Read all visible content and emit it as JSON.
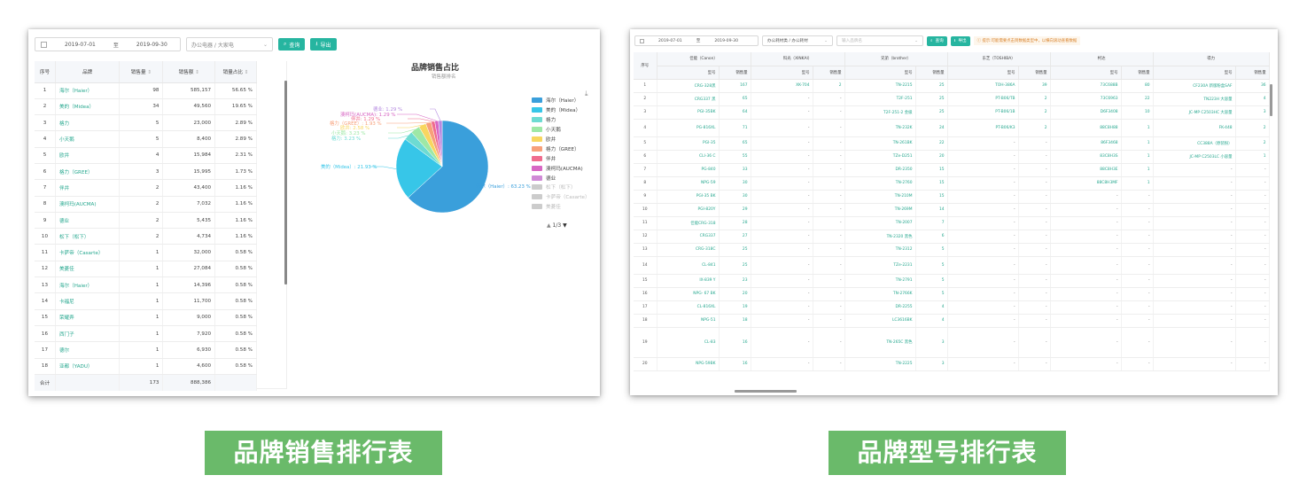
{
  "left": {
    "toolbar": {
      "start_date": "2019-07-01",
      "separator": "至",
      "end_date": "2019-09-30",
      "category": "办公电器 / 大家电",
      "query_label": "查询",
      "export_label": "导出"
    },
    "table": {
      "headers": [
        "序号",
        "品牌",
        "销售量",
        "销售额",
        "销量占比"
      ],
      "rows": [
        [
          "1",
          "海尔（Haier）",
          "98",
          "585,157",
          "56.65 %"
        ],
        [
          "2",
          "美的（Midea）",
          "34",
          "49,560",
          "19.65 %"
        ],
        [
          "3",
          "格力",
          "5",
          "23,000",
          "2.89 %"
        ],
        [
          "4",
          "小天鹅",
          "5",
          "8,400",
          "2.89 %"
        ],
        [
          "5",
          "欧井",
          "4",
          "15,984",
          "2.31 %"
        ],
        [
          "6",
          "格力（GREE）",
          "3",
          "15,995",
          "1.73 %"
        ],
        [
          "7",
          "伴井",
          "2",
          "43,400",
          "1.16 %"
        ],
        [
          "8",
          "澳柯玛(AUCMA)",
          "2",
          "7,032",
          "1.16 %"
        ],
        [
          "9",
          "德业",
          "2",
          "5,435",
          "1.16 %"
        ],
        [
          "10",
          "松下（松下）",
          "2",
          "4,734",
          "1.16 %"
        ],
        [
          "11",
          "卡萨帝（Casarte）",
          "1",
          "32,000",
          "0.58 %"
        ],
        [
          "12",
          "美菱佳",
          "1",
          "27,084",
          "0.58 %"
        ],
        [
          "13",
          "海尔（Haier）",
          "1",
          "14,396",
          "0.58 %"
        ],
        [
          "14",
          "卡福尼",
          "1",
          "11,700",
          "0.58 %"
        ],
        [
          "15",
          "荣耀弄",
          "1",
          "9,000",
          "0.58 %"
        ],
        [
          "16",
          "西门子",
          "1",
          "7,920",
          "0.58 %"
        ],
        [
          "17",
          "德尔",
          "1",
          "6,930",
          "0.58 %"
        ],
        [
          "18",
          "亚都（YADU）",
          "1",
          "4,600",
          "0.58 %"
        ]
      ],
      "total": [
        "合计",
        "",
        "173",
        "888,386",
        ""
      ]
    },
    "chart": {
      "title": "品牌销售占比",
      "subtitle": "销售额排名",
      "pager": "1/3",
      "pie_labels": [
        "海尔（Haier）: 63.23 %",
        "美的（Midea）: 21.93 %",
        "德业: 1.29 %",
        "澳柯玛(AUCMA): 1.29 %",
        "伴井: 1.29 %",
        "格力（GREE）: 1.93 %",
        "欧井: 2.58 %",
        "小天鹅: 3.23 %",
        "格力: 3.23 %"
      ]
    },
    "chart_data": {
      "type": "pie",
      "title": "品牌销售占比",
      "subtitle": "销售额排名",
      "slices": [
        {
          "name": "海尔（Haier）",
          "value": 63.23,
          "color": "#3a9fdb"
        },
        {
          "name": "美的（Midea）",
          "value": 21.93,
          "color": "#37c6e8"
        },
        {
          "name": "格力",
          "value": 3.23,
          "color": "#6ddbd2"
        },
        {
          "name": "小天鹅",
          "value": 3.23,
          "color": "#9ee8a6"
        },
        {
          "name": "欧井",
          "value": 2.58,
          "color": "#f8d65f"
        },
        {
          "name": "格力（GREE）",
          "value": 1.93,
          "color": "#f7a07a"
        },
        {
          "name": "伴井",
          "value": 1.29,
          "color": "#f06c8e"
        },
        {
          "name": "澳柯玛(AUCMA)",
          "value": 1.29,
          "color": "#d867c4"
        },
        {
          "name": "德业",
          "value": 1.29,
          "color": "#b58ae0"
        }
      ],
      "legend": [
        {
          "name": "海尔（Haier）",
          "color": "#3a9fdb"
        },
        {
          "name": "美的（Midea）",
          "color": "#37c6e8"
        },
        {
          "name": "格力",
          "color": "#6ddbd2"
        },
        {
          "name": "小天鹅",
          "color": "#9ee8a6"
        },
        {
          "name": "欧井",
          "color": "#f8d65f"
        },
        {
          "name": "格力（GREE）",
          "color": "#f7a07a"
        },
        {
          "name": "伴井",
          "color": "#f06c8e"
        },
        {
          "name": "澳柯玛(AUCMA)",
          "color": "#d867c4"
        },
        {
          "name": "德业",
          "color": "#d08ad6"
        },
        {
          "name": "松下（松下）",
          "color": "#cccccc"
        },
        {
          "name": "卡萨帝（Casarte）",
          "color": "#cccccc"
        },
        {
          "name": "美菱佳",
          "color": "#cccccc"
        }
      ],
      "legend_position": "right"
    }
  },
  "right": {
    "toolbar": {
      "start_date": "2019-07-01",
      "separator": "至",
      "end_date": "2019-09-30",
      "category": "办公耗材类 / 办公耗材",
      "search_placeholder": "输入品牌名",
      "query_label": "查询",
      "export_label": "导出",
      "notice": "提示:可能需要点击到数据类型中，以横向滚动查看数据"
    },
    "table": {
      "index_header": "序号",
      "brands": [
        "佳能（Canon）",
        "科光（XINKAI）",
        "兄弟（brother）",
        "东芝（TOSHIBA）",
        "柯达",
        "得力"
      ],
      "sub_headers": [
        "型号",
        "销售量"
      ],
      "rows": [
        [
          "1",
          "CRG-328黑",
          "167",
          "XK-704",
          "2",
          "TN-2215",
          "25",
          "TOH-386A",
          "39",
          "73C688B",
          "80",
          "CF230A 新版粉盒SAF",
          "36"
        ],
        [
          "2",
          "CRG337 黑",
          "65",
          "-",
          "-",
          "T2F-251",
          "25",
          "PT-B06/TB",
          "2",
          "73C6963",
          "22",
          "TN223H 大容量",
          "4"
        ],
        [
          "3",
          "PGI-35BK",
          "64",
          "-",
          "-",
          "T2F-251-2 金级",
          "25",
          "PT-B06/1B",
          "2",
          "D6F3408",
          "10",
          "JC-MP C2503HC 大容量",
          "3"
        ],
        [
          "4",
          "PG-816XL",
          "71",
          "-",
          "-",
          "TN-232K",
          "24",
          "PT-B06/K3",
          "2",
          "88C8H88",
          "1",
          "FK-448",
          "2"
        ],
        [
          "5",
          "PGI-35",
          "65",
          "-",
          "-",
          "TN-261BK",
          "22",
          "-",
          "-",
          "86F3468",
          "1",
          "CC388A（原装粉）",
          "2"
        ],
        [
          "6",
          "CLI-36 C",
          "55",
          "-",
          "-",
          "TZe-D251",
          "20",
          "-",
          "-",
          "83C8H3S",
          "1",
          "JC-MP C2503LC 小容量",
          "1"
        ],
        [
          "7",
          "PG-840",
          "33",
          "-",
          "-",
          "DR-2350",
          "15",
          "-",
          "-",
          "88C8H3E",
          "1",
          "-",
          "-"
        ],
        [
          "8",
          "NPG-59",
          "30",
          "-",
          "-",
          "TN-2760",
          "15",
          "-",
          "-",
          "88C8H3MF",
          "1",
          "-",
          "-"
        ],
        [
          "9",
          "PGI-35 BK",
          "30",
          "-",
          "-",
          "TN-210M",
          "15",
          "-",
          "-",
          "-",
          "-",
          "-",
          "-"
        ],
        [
          "10",
          "PGI-820Y",
          "29",
          "-",
          "-",
          "TN-269M",
          "14",
          "-",
          "-",
          "-",
          "-",
          "-",
          "-"
        ],
        [
          "11",
          "佳能CRG-318",
          "28",
          "-",
          "-",
          "TN-2007",
          "7",
          "-",
          "-",
          "-",
          "-",
          "-",
          "-"
        ],
        [
          "12",
          "CRG337",
          "27",
          "-",
          "-",
          "TN-2320 黑色",
          "6",
          "-",
          "-",
          "-",
          "-",
          "-",
          "-"
        ],
        [
          "13",
          "CRG-318C",
          "25",
          "-",
          "-",
          "TN-2312",
          "5",
          "-",
          "-",
          "-",
          "-",
          "-",
          "-"
        ],
        [
          "14",
          "CL-841",
          "25",
          "-",
          "-",
          "TZe-2231",
          "5",
          "-",
          "-",
          "-",
          "-",
          "-",
          "-"
        ],
        [
          "15",
          "IX-839 Y",
          "23",
          "-",
          "-",
          "TN-2791",
          "5",
          "-",
          "-",
          "-",
          "-",
          "-",
          "-"
        ],
        [
          "16",
          "NPG- 67 BK",
          "20",
          "-",
          "-",
          "TN-2766K",
          "5",
          "-",
          "-",
          "-",
          "-",
          "-",
          "-"
        ],
        [
          "17",
          "CL-816XL",
          "19",
          "-",
          "-",
          "DR-2255",
          "4",
          "-",
          "-",
          "-",
          "-",
          "-",
          "-"
        ],
        [
          "18",
          "NPG-51",
          "18",
          "-",
          "-",
          "LC3616BK",
          "4",
          "-",
          "-",
          "-",
          "-",
          "-",
          "-"
        ],
        [
          "19",
          "CL-83",
          "16",
          "-",
          "-",
          "TN-265C 黑色",
          "3",
          "-",
          "-",
          "-",
          "-",
          "-",
          "-"
        ],
        [
          "20",
          "NPG-59BK",
          "16",
          "-",
          "-",
          "TN-2225",
          "3",
          "-",
          "-",
          "-",
          "-",
          "-",
          "-"
        ]
      ]
    }
  },
  "captions": {
    "left": "品牌销售排行表",
    "right": "品牌型号排行表"
  }
}
